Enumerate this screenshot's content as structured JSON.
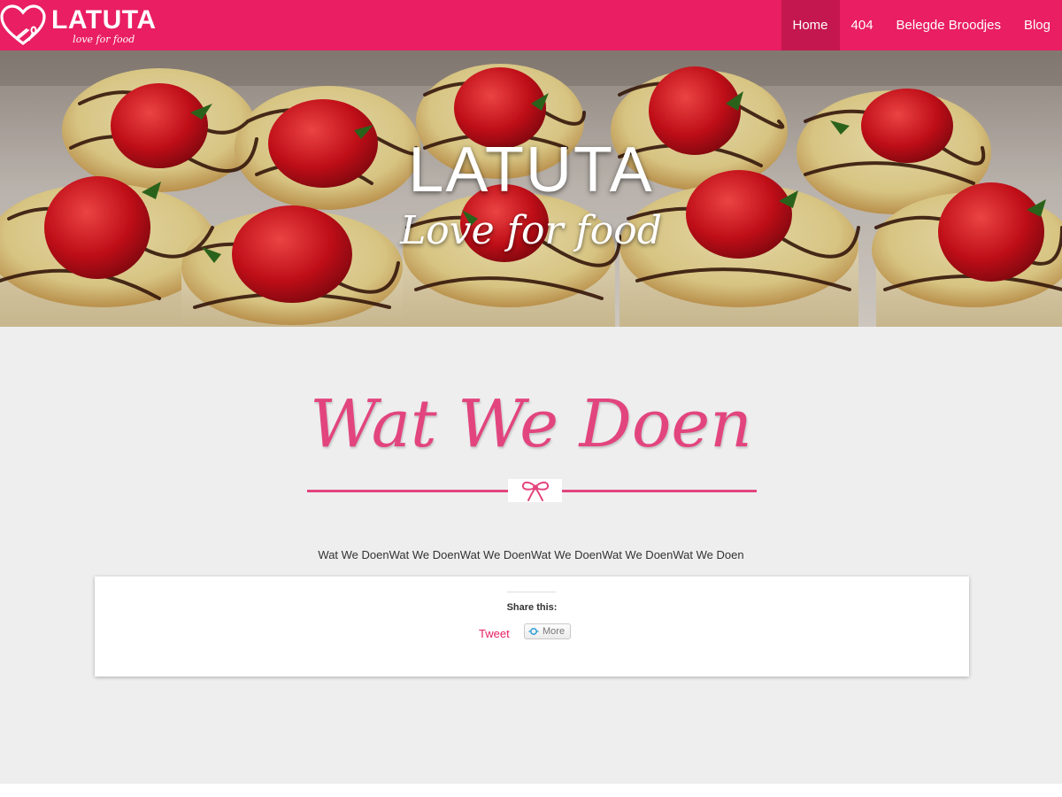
{
  "brand": {
    "name": "LATUTA",
    "tagline": "love for food"
  },
  "nav": {
    "items": [
      {
        "label": "Home",
        "active": true
      },
      {
        "label": "404",
        "active": false
      },
      {
        "label": "Belegde Broodjes",
        "active": false
      },
      {
        "label": "Blog",
        "active": false
      }
    ]
  },
  "hero": {
    "title": "LATUTA",
    "subtitle": "Love for food"
  },
  "section": {
    "title": "Wat We Doen",
    "divider_icon": "bow-icon",
    "text": "Wat We DoenWat We DoenWat We DoenWat We DoenWat We DoenWat We Doen"
  },
  "share": {
    "label": "Share this:",
    "tweet_label": "Tweet",
    "more_label": "More",
    "more_icon": "share-more-icon"
  },
  "colors": {
    "brand_pink": "#e91e63",
    "nav_active": "#c5174f",
    "title_pink": "#e2457e",
    "content_bg": "#eeeeee"
  }
}
